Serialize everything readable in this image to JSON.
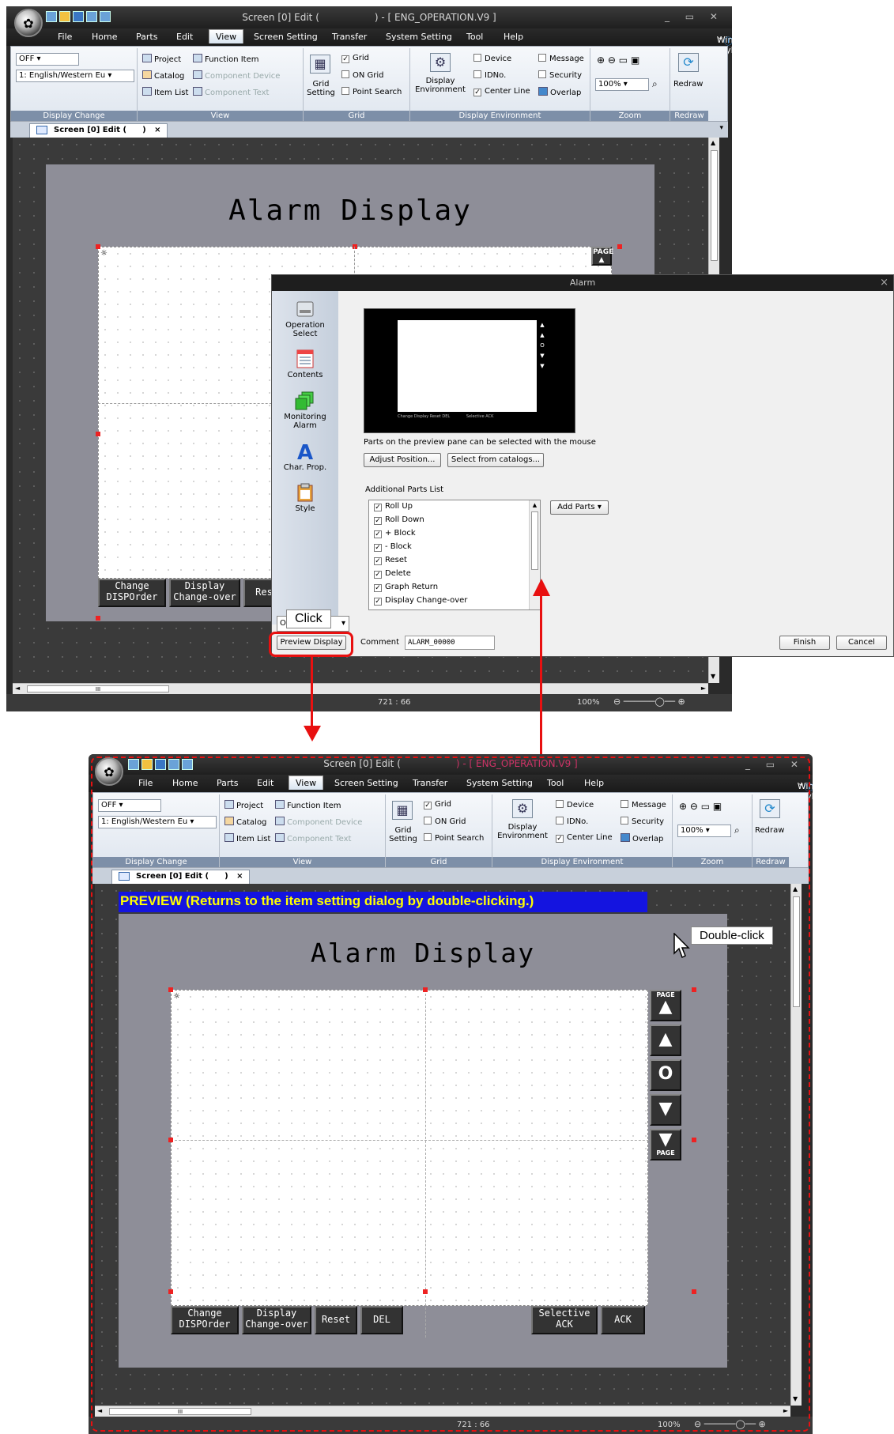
{
  "app": {
    "title_left": "Screen [0] Edit (",
    "title_right": ") - [ ENG_OPERATION.V9 ]",
    "window_style": "Window Style",
    "menu": [
      "File",
      "Home",
      "Parts",
      "Edit",
      "View",
      "Screen Setting",
      "Transfer",
      "System Setting",
      "Tool",
      "Help"
    ],
    "active_menu": "View"
  },
  "ribbon": {
    "display_change": {
      "off": "OFF",
      "language": "1: English/Western Eu",
      "label": "Display Change"
    },
    "view": {
      "project": "Project",
      "function_item": "Function Item",
      "catalog": "Catalog",
      "component_device": "Component Device",
      "item_list": "Item List",
      "component_text": "Component Text",
      "label": "View"
    },
    "grid": {
      "grid_setting": "Grid Setting",
      "grid": "Grid",
      "on_grid": "ON Grid",
      "point_search": "Point Search",
      "label": "Grid"
    },
    "display_env": {
      "display_environment": "Display Environment",
      "device": "Device",
      "message": "Message",
      "idno": "IDNo.",
      "security": "Security",
      "center_line": "Center Line",
      "overlap": "Overlap",
      "label": "Display Environment"
    },
    "zoom": {
      "value": "100%",
      "label": "Zoom"
    },
    "redraw": {
      "button": "Redraw",
      "label": "Redraw"
    }
  },
  "tab": {
    "label": "Screen [0] Edit (",
    "suffix": ")",
    "close": "×"
  },
  "screen": {
    "title": "Alarm Display",
    "page_up": "PAGE",
    "page_down": "PAGE",
    "buttons": {
      "change": "Change\nDISPOrder",
      "display": "Display\nChange-over",
      "reset": "Reset",
      "reset_cut": "Res",
      "del": "DEL",
      "selective": "Selective\nACK",
      "ack": "ACK"
    },
    "scroll_icons": [
      "▲",
      "▲",
      "O",
      "▼",
      "▼"
    ]
  },
  "status": {
    "coords": "721 : 66",
    "zoom": "100%",
    "coords_bottom": "721 : 66",
    "scroll_dots": "III"
  },
  "dialog": {
    "title": "Alarm",
    "close": "×",
    "sidebar": [
      {
        "label": "Operation\nSelect"
      },
      {
        "label": "Contents"
      },
      {
        "label": "Monitoring\nAlarm"
      },
      {
        "label": "Char. Prop."
      },
      {
        "label": "Style"
      }
    ],
    "preview_note": "Parts on the preview pane can be selected with the mouse",
    "adjust_position": "Adjust Position...",
    "select_catalogs": "Select from catalogs...",
    "additional_parts_title": "Additional Parts List",
    "parts": [
      "Roll Up",
      "Roll Down",
      "+ Block",
      "- Block",
      "Reset",
      "Delete",
      "Graph Return",
      "Display Change-over"
    ],
    "add_parts": "Add Parts",
    "other_select": "Ot",
    "preview_display": "Preview Display",
    "comment_label": "Comment",
    "comment_value": "ALARM_00000",
    "finish": "Finish",
    "cancel": "Cancel",
    "mini_labels": [
      "Change",
      "Display",
      "Reset",
      "DEL",
      "Selective",
      "ACK"
    ]
  },
  "callouts": {
    "click": "Click",
    "double_click": "Double-click"
  },
  "preview_banner": "PREVIEW (Returns to the item setting dialog by double-clicking.)",
  "colors": {
    "accent_red": "#e81010",
    "banner_bg": "#1414e0",
    "banner_text": "#ffff00",
    "ribbon_group_label": "#7d8fa8"
  }
}
